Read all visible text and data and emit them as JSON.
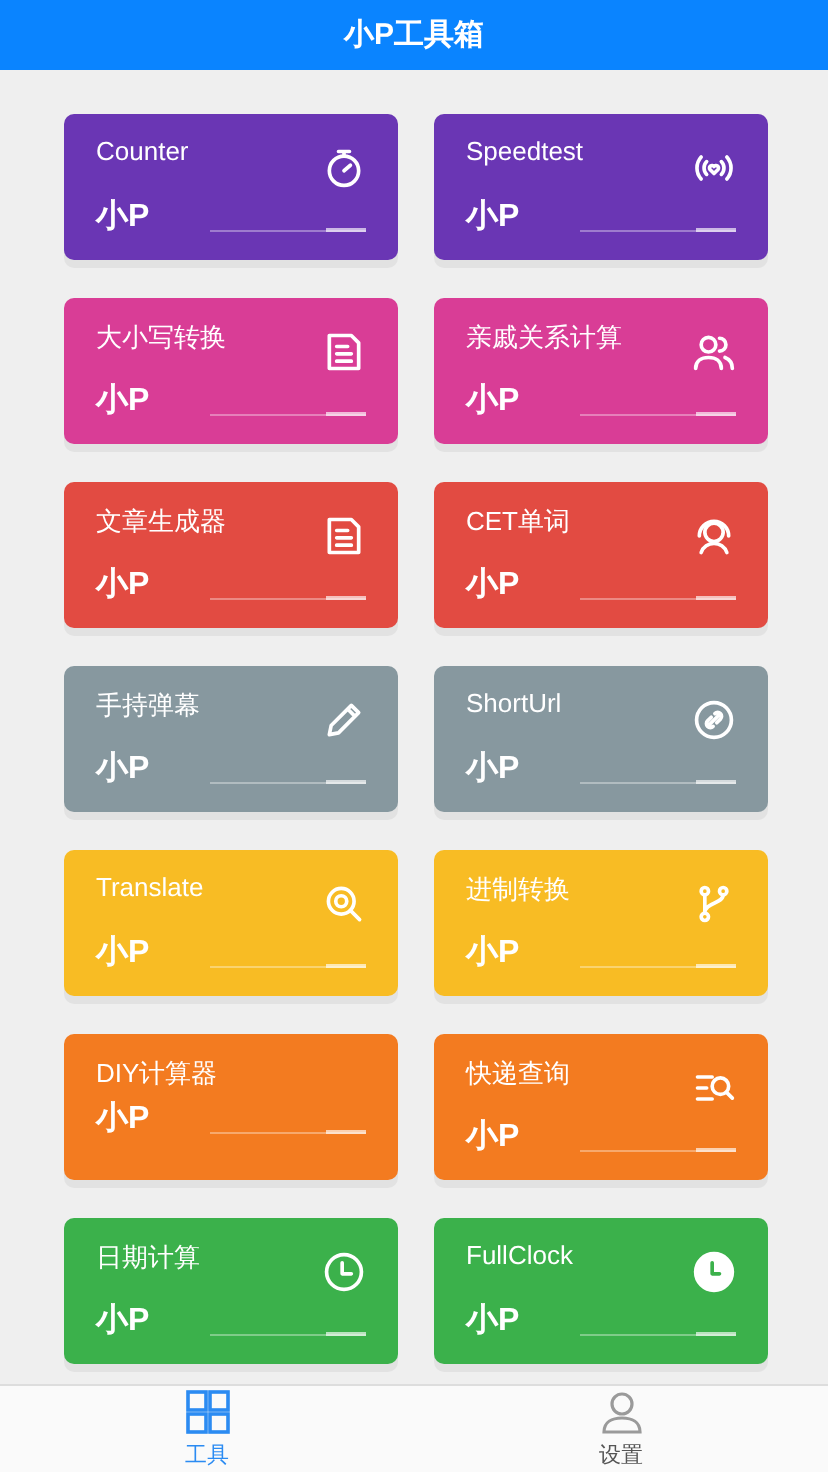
{
  "header": {
    "title": "小P工具箱"
  },
  "cards": [
    {
      "title": "Counter",
      "brand": "小P",
      "color": "#6a36b4"
    },
    {
      "title": "Speedtest",
      "brand": "小P",
      "color": "#6a36b4"
    },
    {
      "title": "大小写转换",
      "brand": "小P",
      "color": "#d93d96"
    },
    {
      "title": "亲戚关系计算",
      "brand": "小P",
      "color": "#d93d96"
    },
    {
      "title": "文章生成器",
      "brand": "小P",
      "color": "#e24b42"
    },
    {
      "title": "CET单词",
      "brand": "小P",
      "color": "#e24b42"
    },
    {
      "title": "手持弹幕",
      "brand": "小P",
      "color": "#87989f"
    },
    {
      "title": "ShortUrl",
      "brand": "小P",
      "color": "#87989f"
    },
    {
      "title": "Translate",
      "brand": "小P",
      "color": "#f8bc24"
    },
    {
      "title": "进制转换",
      "brand": "小P",
      "color": "#f8bc24"
    },
    {
      "title": "DIY计算器",
      "brand": "小P",
      "color": "#f37b20"
    },
    {
      "title": "快递查询",
      "brand": "小P",
      "color": "#f37b20"
    },
    {
      "title": "日期计算",
      "brand": "小P",
      "color": "#3bb14b"
    },
    {
      "title": "FullClock",
      "brand": "小P",
      "color": "#3bb14b"
    }
  ],
  "tabs": [
    {
      "label": "工具",
      "selected": true
    },
    {
      "label": "设置",
      "selected": false
    }
  ]
}
